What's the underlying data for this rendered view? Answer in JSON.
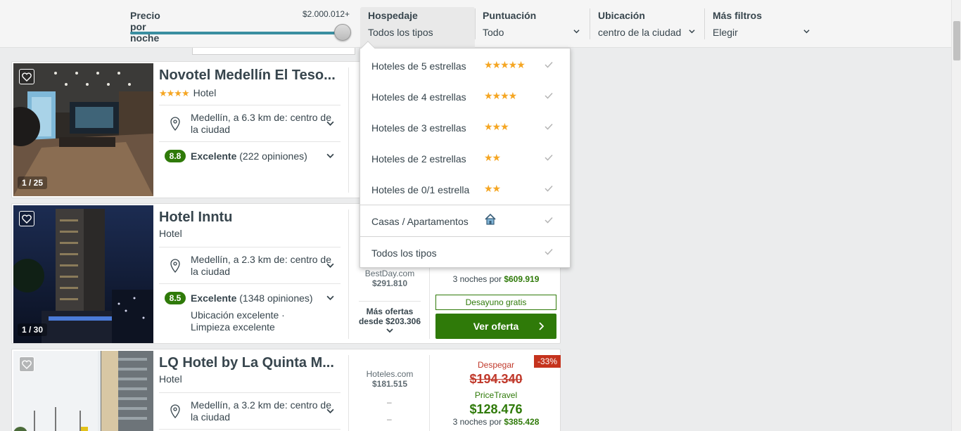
{
  "filters": {
    "price": {
      "label": "Precio por noche",
      "max": "$2.000.012+",
      "level_percent": 100
    },
    "lodging": {
      "label": "Hospedaje",
      "value": "Todos los tipos"
    },
    "rating": {
      "label": "Puntuación",
      "value": "Todo"
    },
    "location": {
      "label": "Ubicación",
      "value": "centro de la ciudad"
    },
    "more": {
      "label": "Más filtros",
      "value": "Elegir"
    }
  },
  "dropdown": {
    "items": [
      {
        "label": "Hoteles de 5 estrellas",
        "stars": "★★★★★"
      },
      {
        "label": "Hoteles de 4 estrellas",
        "stars": "★★★★"
      },
      {
        "label": "Hoteles de 3 estrellas",
        "stars": "★★★"
      },
      {
        "label": "Hoteles de 2 estrellas",
        "stars": "★★"
      },
      {
        "label": "Hoteles de 0/1 estrella",
        "stars": "★★"
      },
      {
        "label": "Casas / Apartamentos",
        "icon": "house-icon"
      },
      {
        "label": "Todos los tipos"
      }
    ]
  },
  "results": [
    {
      "name": "Novotel Medellín El Teso...",
      "stars": "★★★★",
      "type": "Hotel",
      "location": "Medellín, a 6.3 km de: centro de la ciudad",
      "score": "8.8",
      "rating_word": "Excelente",
      "reviews": "(222 opiniones)",
      "photo_counter": "1 / 25"
    },
    {
      "name": "Hotel Inntu",
      "type": "Hotel",
      "location": "Medellín, a 2.3 km de: centro de la ciudad",
      "score": "8.5",
      "rating_word": "Excelente",
      "reviews": "(1348 opiniones)",
      "highlights": "Ubicación excelente ·",
      "highlights2": "Limpieza excelente",
      "photo_counter": "1 / 30",
      "provider": "BestDay.com",
      "provider_price": "$291.810",
      "more_offers": "Más ofertas",
      "more_offers_from": "desde $203.306",
      "nights_label": "3 noches por",
      "nights_price": "$609.919",
      "breakfast": "Desayuno gratis",
      "cta": "Ver oferta"
    },
    {
      "name": "LQ Hotel by La Quinta M...",
      "type": "Hotel",
      "location": "Medellín, a 3.2 km de: centro de la ciudad",
      "provider": "Hoteles.com",
      "provider_price": "$181.515",
      "dash1": "–",
      "dash2": "–",
      "discount": "-33%",
      "old_provider": "Despegar",
      "old_price": "$194.340",
      "deal_provider": "PriceTravel",
      "deal_price": "$128.476",
      "nights_label": "3 noches por",
      "nights_price": "$385.428"
    }
  ],
  "colors": {
    "accent_green": "#2f7a09",
    "slider": "#3a8ea0",
    "star": "#f5a623",
    "discount_red": "#c5331d"
  }
}
